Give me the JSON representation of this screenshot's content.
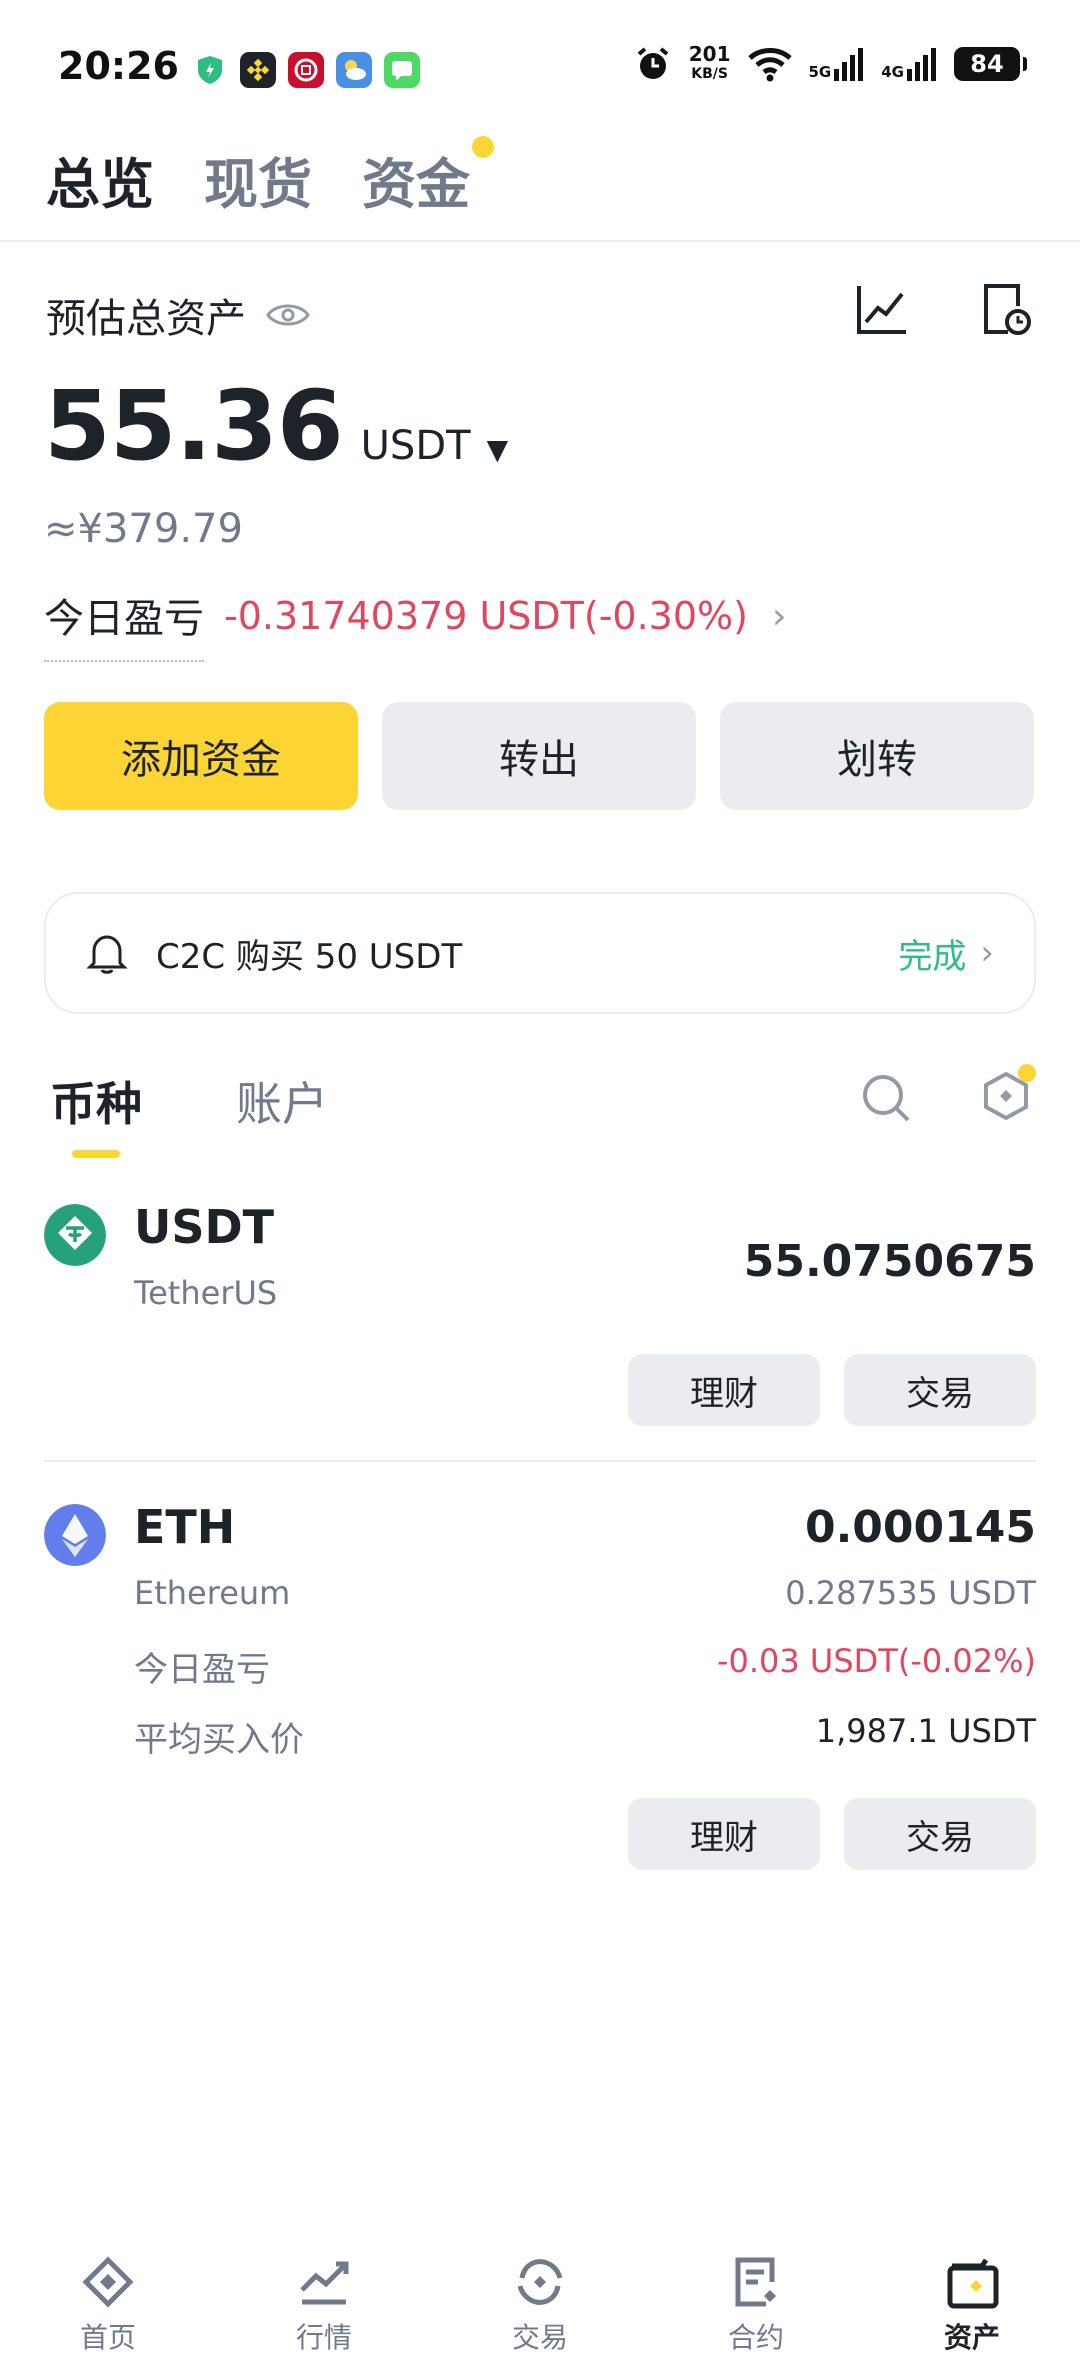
{
  "status_bar": {
    "time": "20:26",
    "net_speed": "201",
    "net_unit": "KB/S",
    "signal_1": "5G",
    "signal_2": "4G",
    "battery": "84"
  },
  "top_tabs": [
    {
      "label": "总览",
      "active": true
    },
    {
      "label": "现货",
      "active": false
    },
    {
      "label": "资金",
      "active": false
    }
  ],
  "header": {
    "label": "预估总资产",
    "balance": "55.36",
    "unit": "USDT",
    "cny": "≈¥379.79",
    "pnl_label": "今日盈亏",
    "pnl_value": "-0.31740379 USDT(-0.30%)"
  },
  "actions": {
    "add_funds": "添加资金",
    "withdraw": "转出",
    "transfer": "划转"
  },
  "c2c": {
    "text": "C2C 购买 50 USDT",
    "status": "完成"
  },
  "sub_tabs": {
    "coins": "币种",
    "accounts": "账户"
  },
  "coins": [
    {
      "symbol": "USDT",
      "name": "TetherUS",
      "amount": "55.0750675",
      "earn_label": "理财",
      "trade_label": "交易"
    },
    {
      "symbol": "ETH",
      "name": "Ethereum",
      "amount": "0.000145",
      "value": "0.287535 USDT",
      "pnl_label": "今日盈亏",
      "pnl_value": "-0.03 USDT(-0.02%)",
      "avg_label": "平均买入价",
      "avg_value": "1,987.1 USDT",
      "earn_label": "理财",
      "trade_label": "交易"
    }
  ],
  "bottom_nav": [
    {
      "label": "首页",
      "icon": "home-icon"
    },
    {
      "label": "行情",
      "icon": "markets-icon"
    },
    {
      "label": "交易",
      "icon": "trade-icon"
    },
    {
      "label": "合约",
      "icon": "futures-icon"
    },
    {
      "label": "资产",
      "icon": "wallet-icon",
      "active": true
    }
  ],
  "colors": {
    "accent": "#fcd535",
    "negative": "#e0465e",
    "positive": "#2ebd85",
    "usdt": "#26a17b",
    "eth": "#627eea"
  }
}
